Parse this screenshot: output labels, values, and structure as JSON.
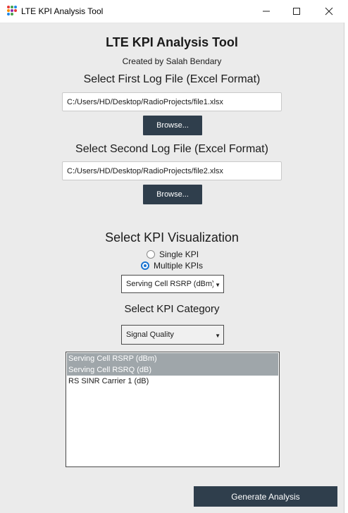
{
  "window": {
    "title": "LTE KPI Analysis Tool",
    "minimize_icon": "minimize-icon",
    "maximize_icon": "maximize-icon",
    "close_icon": "close-icon"
  },
  "header": {
    "title": "LTE KPI Analysis Tool",
    "subtitle": "Created by Salah Bendary"
  },
  "file1": {
    "heading": "Select First Log File (Excel Format)",
    "path": "C:/Users/HD/Desktop/RadioProjects/file1.xlsx",
    "browse_label": "Browse..."
  },
  "file2": {
    "heading": "Select Second Log File (Excel Format)",
    "path": "C:/Users/HD/Desktop/RadioProjects/file2.xlsx",
    "browse_label": "Browse..."
  },
  "visualization": {
    "heading": "Select KPI Visualization",
    "options": [
      {
        "label": "Single KPI",
        "checked": false
      },
      {
        "label": "Multiple KPIs",
        "checked": true
      }
    ],
    "kpi_dropdown_value": "Serving Cell RSRP (dBm)"
  },
  "category": {
    "heading": "Select KPI Category",
    "dropdown_value": "Signal Quality"
  },
  "kpi_list": {
    "items": [
      {
        "label": "Serving Cell RSRP (dBm)",
        "selected": true
      },
      {
        "label": "Serving Cell RSRQ (dB)",
        "selected": true
      },
      {
        "label": "RS SINR Carrier 1 (dB)",
        "selected": false
      }
    ]
  },
  "actions": {
    "generate_label": "Generate Analysis"
  },
  "colors": {
    "accent_button": "#2f3e4c",
    "background": "#ebebeb",
    "selection": "#9fa6aa",
    "radio_checked": "#1a74d1"
  }
}
